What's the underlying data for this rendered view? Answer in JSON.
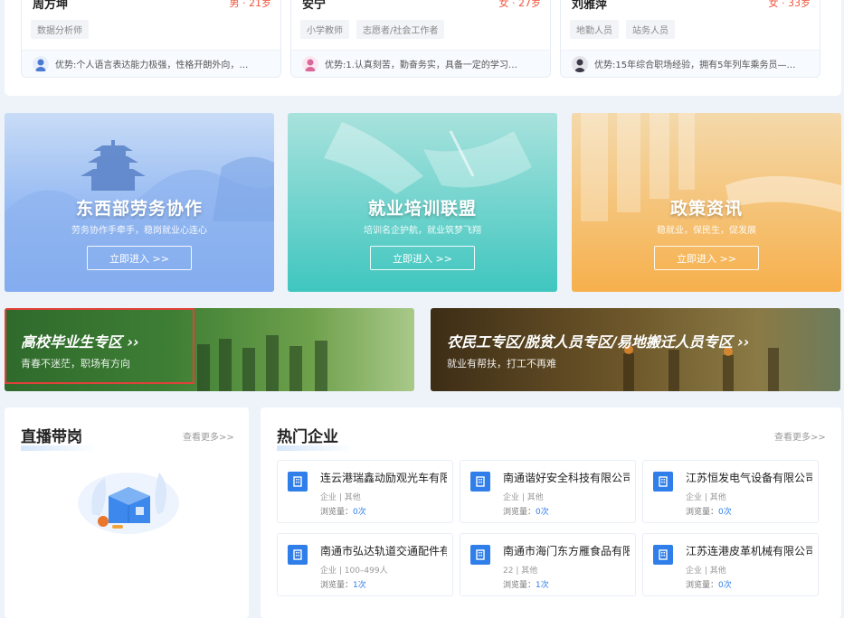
{
  "talents": [
    {
      "name": "周方坤",
      "meta": "男 · 21岁",
      "tags": [
        "数据分析师"
      ],
      "summary": "优势:个人语言表达能力极强，性格开朗外向，…",
      "avatar_color": "#4a7bd0"
    },
    {
      "name": "安宁",
      "meta": "女 · 27岁",
      "tags": [
        "小学教师",
        "志愿者/社会工作者"
      ],
      "summary": "优势:1.认真刻苦，勤奋务实，具备一定的学习…",
      "avatar_color": "#d9689a"
    },
    {
      "name": "刘雅萍",
      "meta": "女 · 33岁",
      "tags": [
        "地勤人员",
        "站务人员"
      ],
      "summary": "优势:15年综合职场经验，拥有5年列车乘务员—…",
      "avatar_color": "#3a3a48"
    }
  ],
  "promos": [
    {
      "title": "东西部劳务协作",
      "subtitle": "劳务协作手牵手，稳岗就业心连心",
      "button": "立即进入 >>",
      "color_top": "#bcd3f3",
      "color_bottom": "#6c9ff0"
    },
    {
      "title": "就业培训联盟",
      "subtitle": "培训名企护航，就业筑梦飞翔",
      "button": "立即进入 >>",
      "color_top": "#a6e3de",
      "color_bottom": "#3ec7c0"
    },
    {
      "title": "政策资讯",
      "subtitle": "稳就业，保民生，促发展",
      "button": "立即进入 >>",
      "color_top": "#f5d7a6",
      "color_bottom": "#f6b24f"
    }
  ],
  "zones": [
    {
      "title": "高校毕业生专区 ››",
      "subtitle": "青春不迷茫，职场有方向"
    },
    {
      "title": "农民工专区/脱贫人员专区/易地搬迁人员专区 ››",
      "subtitle": "就业有帮扶，打工不再难"
    }
  ],
  "live": {
    "title": "直播带岗",
    "more": "查看更多>>"
  },
  "hot": {
    "title": "热门企业",
    "more": "查看更多>>",
    "views_label": "浏览量：",
    "companies": [
      {
        "name": "连云港瑞鑫动励观光车有限公司",
        "type": "企业 | 其他",
        "views": "0次"
      },
      {
        "name": "南通谐好安全科技有限公司",
        "type": "企业 | 其他",
        "views": "0次"
      },
      {
        "name": "江苏恒发电气设备有限公司",
        "type": "企业 | 其他",
        "views": "0次"
      },
      {
        "name": "南通市弘达轨道交通配件有限公司",
        "type": "企业 | 100–499人",
        "views": "1次"
      },
      {
        "name": "南通市海门东方雁食品有限公司",
        "type": "22 | 其他",
        "views": "1次"
      },
      {
        "name": "江苏连港皮革机械有限公司",
        "type": "企业 | 其他",
        "views": "0次"
      }
    ]
  },
  "accent": "#2f7ee9",
  "highlight_color": "#e0413a"
}
